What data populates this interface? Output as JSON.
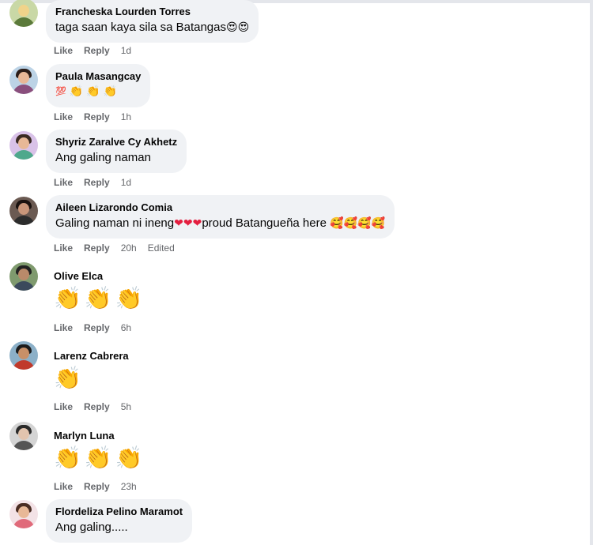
{
  "labels": {
    "like": "Like",
    "reply": "Reply",
    "edited": "Edited"
  },
  "comments": [
    {
      "author": "Francheska Lourden Torres",
      "text": "taga saan kaya sila sa Batangas",
      "time": "1d",
      "emojis": [
        "😍",
        "😍"
      ]
    },
    {
      "author": "Paula Masangcay",
      "text": "",
      "time": "1h",
      "emojis": [
        "💯",
        "👏",
        "👏",
        "👏"
      ]
    },
    {
      "author": "Shyriz Zaralve Cy Akhetz",
      "text": "Ang galing naman",
      "time": "1d",
      "emojis": []
    },
    {
      "author": "Aileen Lizarondo Comia",
      "text_before": "Galing naman ni ineng",
      "hearts": [
        "❤",
        "❤",
        "❤"
      ],
      "text_after": "proud Batangueña here ",
      "trailing_emojis": [
        "🥰",
        "🥰",
        "🥰",
        "🥰"
      ],
      "time": "20h",
      "edited": true
    },
    {
      "author": "Olive Elca",
      "text": "",
      "time": "6h",
      "emojis": [
        "👏",
        "👏",
        "👏"
      ]
    },
    {
      "author": "Larenz Cabrera",
      "text": "",
      "time": "5h",
      "emojis": [
        "👏"
      ]
    },
    {
      "author": "Marlyn Luna",
      "text": "",
      "time": "23h",
      "emojis": [
        "👏",
        "👏",
        "👏"
      ]
    },
    {
      "author": "Flordeliza Pelino Maramot",
      "text": "Ang galing.....",
      "time": "",
      "emojis": []
    }
  ],
  "colors": {
    "bubble": "#f0f2f5",
    "action_text": "#65676b",
    "heart": "#e41e3f",
    "emoji_yellow": "#f7b928"
  }
}
